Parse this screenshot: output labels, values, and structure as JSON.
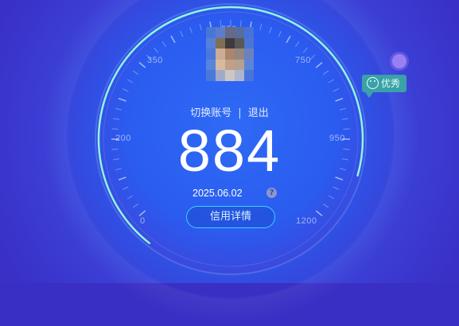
{
  "gauge": {
    "ticks": [
      "0",
      "200",
      "350",
      "550",
      "750",
      "950",
      "1200"
    ]
  },
  "account": {
    "switch_label": "切换账号",
    "separator": "|",
    "logout_label": "退出"
  },
  "score": {
    "value": "884",
    "date": "2025.06.02",
    "help_glyph": "?",
    "level_label": "优秀"
  },
  "actions": {
    "detail_label": "信用详情"
  },
  "colors": {
    "progress_arc": "#8ff5e1",
    "button_border": "#36d3ff",
    "badge": "#3aa1a8",
    "indicator_dot": "#9a7ff3"
  }
}
